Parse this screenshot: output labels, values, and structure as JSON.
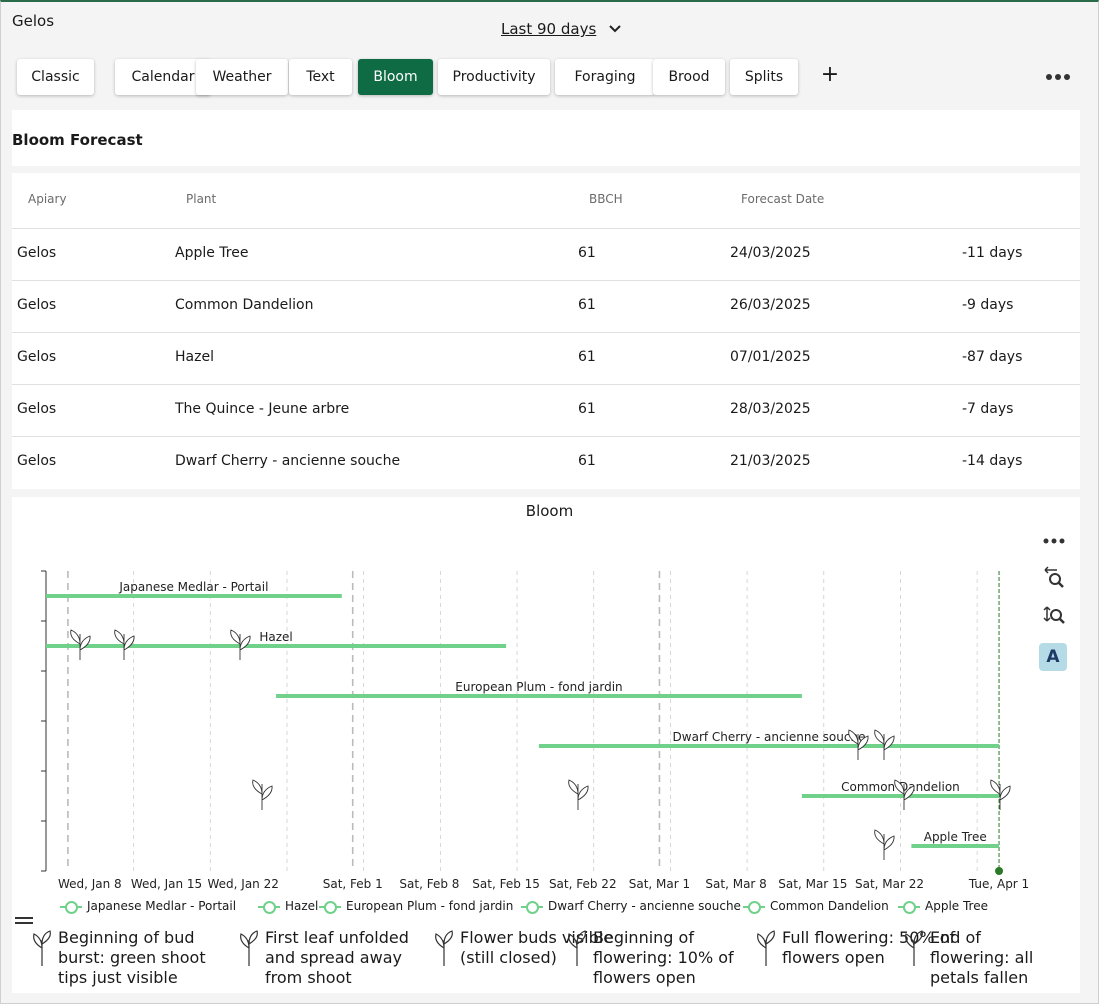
{
  "header": {
    "title": "Gelos",
    "range_label": "Last 90 days"
  },
  "tabs": [
    {
      "label": "Classic",
      "active": false
    },
    {
      "label": "Calendar",
      "active": false
    },
    {
      "label": "Weather",
      "active": false
    },
    {
      "label": "Text",
      "active": false
    },
    {
      "label": "Bloom",
      "active": true
    },
    {
      "label": "Productivity",
      "active": false
    },
    {
      "label": "Foraging",
      "active": false
    },
    {
      "label": "Brood",
      "active": false
    },
    {
      "label": "Splits",
      "active": false
    }
  ],
  "add_tab_label": "+",
  "forecast": {
    "title": "Bloom Forecast",
    "columns": [
      "Apiary",
      "Plant",
      "BBCH",
      "Forecast Date"
    ],
    "rows": [
      {
        "apiary": "Gelos",
        "plant": "Apple Tree",
        "bbch": "61",
        "date": "24/03/2025",
        "delta": "-11 days"
      },
      {
        "apiary": "Gelos",
        "plant": "Common Dandelion",
        "bbch": "61",
        "date": "26/03/2025",
        "delta": "-9 days"
      },
      {
        "apiary": "Gelos",
        "plant": "Hazel",
        "bbch": "61",
        "date": "07/01/2025",
        "delta": "-87 days"
      },
      {
        "apiary": "Gelos",
        "plant": "The Quince - Jeune arbre",
        "bbch": "61",
        "date": "28/03/2025",
        "delta": "-7 days"
      },
      {
        "apiary": "Gelos",
        "plant": "Dwarf Cherry - ancienne souche",
        "bbch": "61",
        "date": "21/03/2025",
        "delta": "-14 days"
      }
    ]
  },
  "chart_toolbar": {
    "mode_label": "A",
    "icons": [
      "more-icon",
      "zoom-x-icon",
      "zoom-y-icon"
    ]
  },
  "chart_data": {
    "type": "timeline",
    "title": "Bloom",
    "x_ticks": [
      "Wed, Jan 8",
      "Wed, Jan 15",
      "Wed, Jan 22",
      "Sat, Feb 1",
      "Sat, Feb 8",
      "Sat, Feb 15",
      "Sat, Feb 22",
      "Sat, Mar 1",
      "Sat, Mar 8",
      "Sat, Mar 15",
      "Sat, Mar 22",
      "Tue, Apr 1"
    ],
    "x_range": [
      "2025-01-04",
      "2025-04-02"
    ],
    "today_marker": "2025-04-01",
    "series": [
      {
        "name": "Japanese Medlar - Portail",
        "start": "2025-01-04",
        "end": "2025-01-31"
      },
      {
        "name": "Hazel",
        "start": "2025-01-04",
        "end": "2025-02-15"
      },
      {
        "name": "European Plum - fond jardin",
        "start": "2025-01-25",
        "end": "2025-03-14"
      },
      {
        "name": "Dwarf Cherry - ancienne souche",
        "start": "2025-02-18",
        "end": "2025-04-01"
      },
      {
        "name": "Common Dandelion",
        "start": "2025-03-14",
        "end": "2025-04-01"
      },
      {
        "name": "Apple Tree",
        "start": "2025-03-24",
        "end": "2025-04-01"
      }
    ],
    "color": "#6fd18a"
  },
  "bbch_stages": [
    {
      "label": "Beginning of bud burst: green shoot tips just visible",
      "icon": "bud-burst-icon"
    },
    {
      "label": "First leaf unfolded and spread away from shoot",
      "icon": "first-leaf-icon"
    },
    {
      "label": "Flower buds visible (still closed)",
      "icon": "flower-buds-icon"
    },
    {
      "label": "Beginning of flowering: 10% of flowers open",
      "icon": "flowering-start-icon"
    },
    {
      "label": "Full flowering: 50% of flowers open",
      "icon": "full-flowering-icon"
    },
    {
      "label": "End of flowering: all petals fallen",
      "icon": "flowering-end-icon"
    }
  ]
}
